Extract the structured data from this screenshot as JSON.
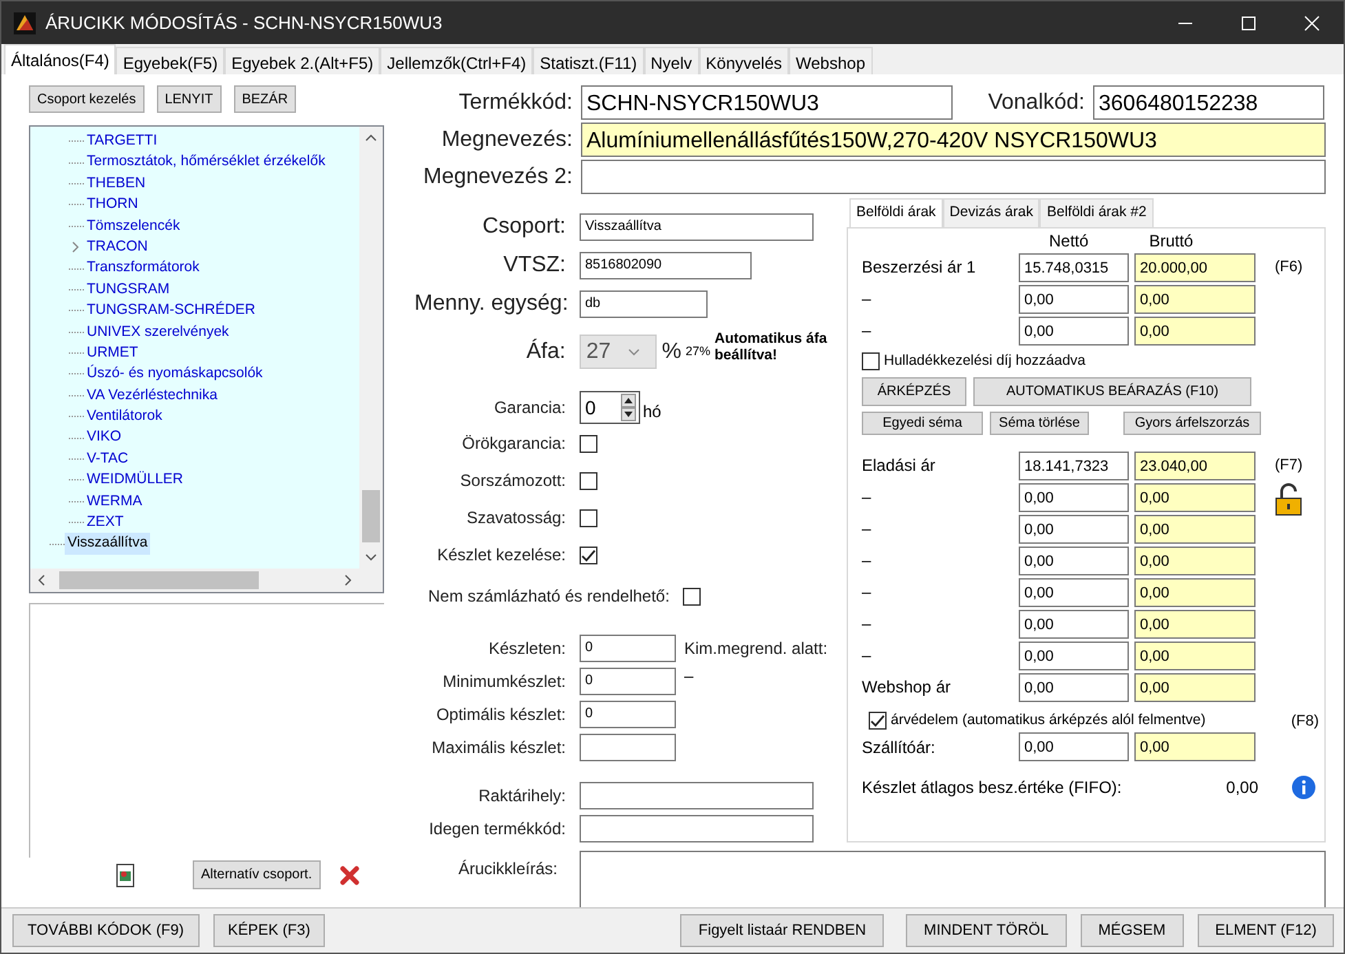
{
  "window": {
    "title": "ÁRUCIKK MÓDOSÍTÁS - SCHN-NSYCR150WU3"
  },
  "tabs": [
    {
      "label": "Általános(F4)",
      "selected": true
    },
    {
      "label": "Egyebek(F5)",
      "selected": false
    },
    {
      "label": "Egyebek 2.(Alt+F5)",
      "selected": false
    },
    {
      "label": "Jellemzők(Ctrl+F4)",
      "selected": false
    },
    {
      "label": "Statiszt.(F11)",
      "selected": false
    },
    {
      "label": "Nyelv",
      "selected": false
    },
    {
      "label": "Könyvelés",
      "selected": false
    },
    {
      "label": "Webshop",
      "selected": false
    }
  ],
  "group_panel": {
    "buttons": [
      "Csoport kezelés",
      "LENYIT",
      "BEZÁR"
    ],
    "tree": [
      {
        "children": [
          {
            "label": "TARGETTI",
            "selected": false
          },
          {
            "label": "Termosztátok, hőmérséklet érzékelők",
            "selected": false
          },
          {
            "label": "THEBEN",
            "selected": false
          },
          {
            "label": "THORN",
            "selected": false
          },
          {
            "label": "Tömszelencék",
            "selected": false
          },
          {
            "label": "TRACON",
            "selected": false,
            "expanded": false
          },
          {
            "label": "Transzformátorok",
            "selected": false
          },
          {
            "label": "TUNGSRAM",
            "selected": false
          },
          {
            "label": "TUNGSRAM-SCHRÉDER",
            "selected": false
          },
          {
            "label": "UNIVEX szerelvények",
            "selected": false
          },
          {
            "label": "URMET",
            "selected": false
          },
          {
            "label": "Úszó- és nyomáskapcsolók",
            "selected": false
          },
          {
            "label": "VA Vezérléstechnika",
            "selected": false
          },
          {
            "label": "Ventilátorok",
            "selected": false
          },
          {
            "label": "VIKO",
            "selected": false
          },
          {
            "label": "V-TAC",
            "selected": false
          },
          {
            "label": "WEIDMÜLLER",
            "selected": false
          },
          {
            "label": "WERMA",
            "selected": false
          },
          {
            "label": "ZEXT",
            "selected": false
          }
        ]
      },
      {
        "label": "Visszaállítva",
        "selected": true
      }
    ],
    "alt_button": "Alternatív csoport."
  },
  "product": {
    "code_label": "Termékkód:",
    "code": "SCHN-NSYCR150WU3",
    "barcode_label": "Vonalkód:",
    "barcode": "3606480152238",
    "names": [
      {
        "label": "Megnevezés:",
        "value": "Alumíniumellenállásfűtés150W,270-420V NSYCR150WU3",
        "highlighted": true
      },
      {
        "label": "Megnevezés 2:",
        "highlighted": false
      }
    ]
  },
  "details": {
    "fields": [
      {
        "label": "Csoport:",
        "value": "Visszaállítva"
      },
      {
        "label": "VTSZ:",
        "value": "8516802090"
      },
      {
        "label": "Menny. egység:",
        "value": "db"
      }
    ],
    "vat": {
      "label": "Áfa:",
      "value": "27",
      "unit": "%",
      "reading": "27%",
      "note": "Automatikus áfa beállítva!"
    },
    "warranty": {
      "label": "Garancia:",
      "value": "0",
      "unit": "hó"
    },
    "checks": [
      {
        "label": "Örökgarancia:",
        "checked": false
      },
      {
        "label": "Sorszámozott:",
        "checked": false
      },
      {
        "label": "Szavatosság:",
        "checked": false
      },
      {
        "label": "Készlet kezelése:",
        "checked": true
      }
    ],
    "not_billable": {
      "label": "Nem számlázható és rendelhető:",
      "checked": false
    },
    "stock": [
      {
        "label": "Készleten:",
        "value": "0"
      },
      {
        "label": "Minimumkészlet:",
        "value": "0"
      },
      {
        "label": "Optimális készlet:",
        "value": "0"
      },
      {
        "label": "Maximális készlet:"
      }
    ],
    "below_order": {
      "label": "Kim.megrend. alatt:",
      "value": "–"
    },
    "location": [
      {
        "label": "Raktárihely:"
      },
      {
        "label": "Idegen termékkód:"
      }
    ],
    "description_label": "Árucikkleírás:"
  },
  "prices": {
    "tabs": [
      {
        "label": "Belföldi árak",
        "selected": true
      },
      {
        "label": "Devizás árak",
        "selected": false
      },
      {
        "label": "Belföldi árak #2",
        "selected": false
      }
    ],
    "net_header": "Nettó",
    "gross_header": "Bruttó",
    "purchase": [
      {
        "label": "Beszerzési ár 1",
        "net": "15.748,0315",
        "gross": "20.000,00",
        "key": "(F6)"
      },
      {
        "label": "–",
        "net": "0,00",
        "gross": "0,00"
      },
      {
        "label": "–",
        "net": "0,00",
        "gross": "0,00"
      }
    ],
    "waste_fee": {
      "label": "Hulladékkezelési díj hozzáadva",
      "checked": false
    },
    "buttons_1": [
      "ÁRKÉPZÉS",
      "AUTOMATIKUS BEÁRAZÁS (F10)"
    ],
    "buttons_2": [
      "Egyedi séma",
      "Séma törlése",
      "Gyors árfelszorzás"
    ],
    "sales": [
      {
        "label": "Eladási ár",
        "net": "18.141,7323",
        "gross": "23.040,00",
        "key": "(F7)"
      },
      {
        "label": "–",
        "net": "0,00",
        "gross": "0,00"
      },
      {
        "label": "–",
        "net": "0,00",
        "gross": "0,00"
      },
      {
        "label": "–",
        "net": "0,00",
        "gross": "0,00"
      },
      {
        "label": "–",
        "net": "0,00",
        "gross": "0,00"
      },
      {
        "label": "–",
        "net": "0,00",
        "gross": "0,00"
      },
      {
        "label": "–",
        "net": "0,00",
        "gross": "0,00"
      },
      {
        "label": "Webshop ár",
        "net": "0,00",
        "gross": "0,00"
      }
    ],
    "protection": {
      "label": "árvédelem (automatikus árképzés alól felmentve)",
      "checked": true,
      "key": "(F8)"
    },
    "supplier": {
      "label": "Szállítóár:",
      "net": "0,00",
      "gross": "0,00"
    },
    "fifo": {
      "label": "Készlet átlagos besz.értéke (FIFO):",
      "value": "0,00"
    }
  },
  "bottom_left": [
    "TOVÁBBI KÓDOK (F9)",
    "KÉPEK (F3)"
  ],
  "bottom_right": [
    "Figyelt listaár RENDBEN",
    "MINDENT TÖRÖL",
    "MÉGSEM",
    "ELMENT (F12)"
  ]
}
